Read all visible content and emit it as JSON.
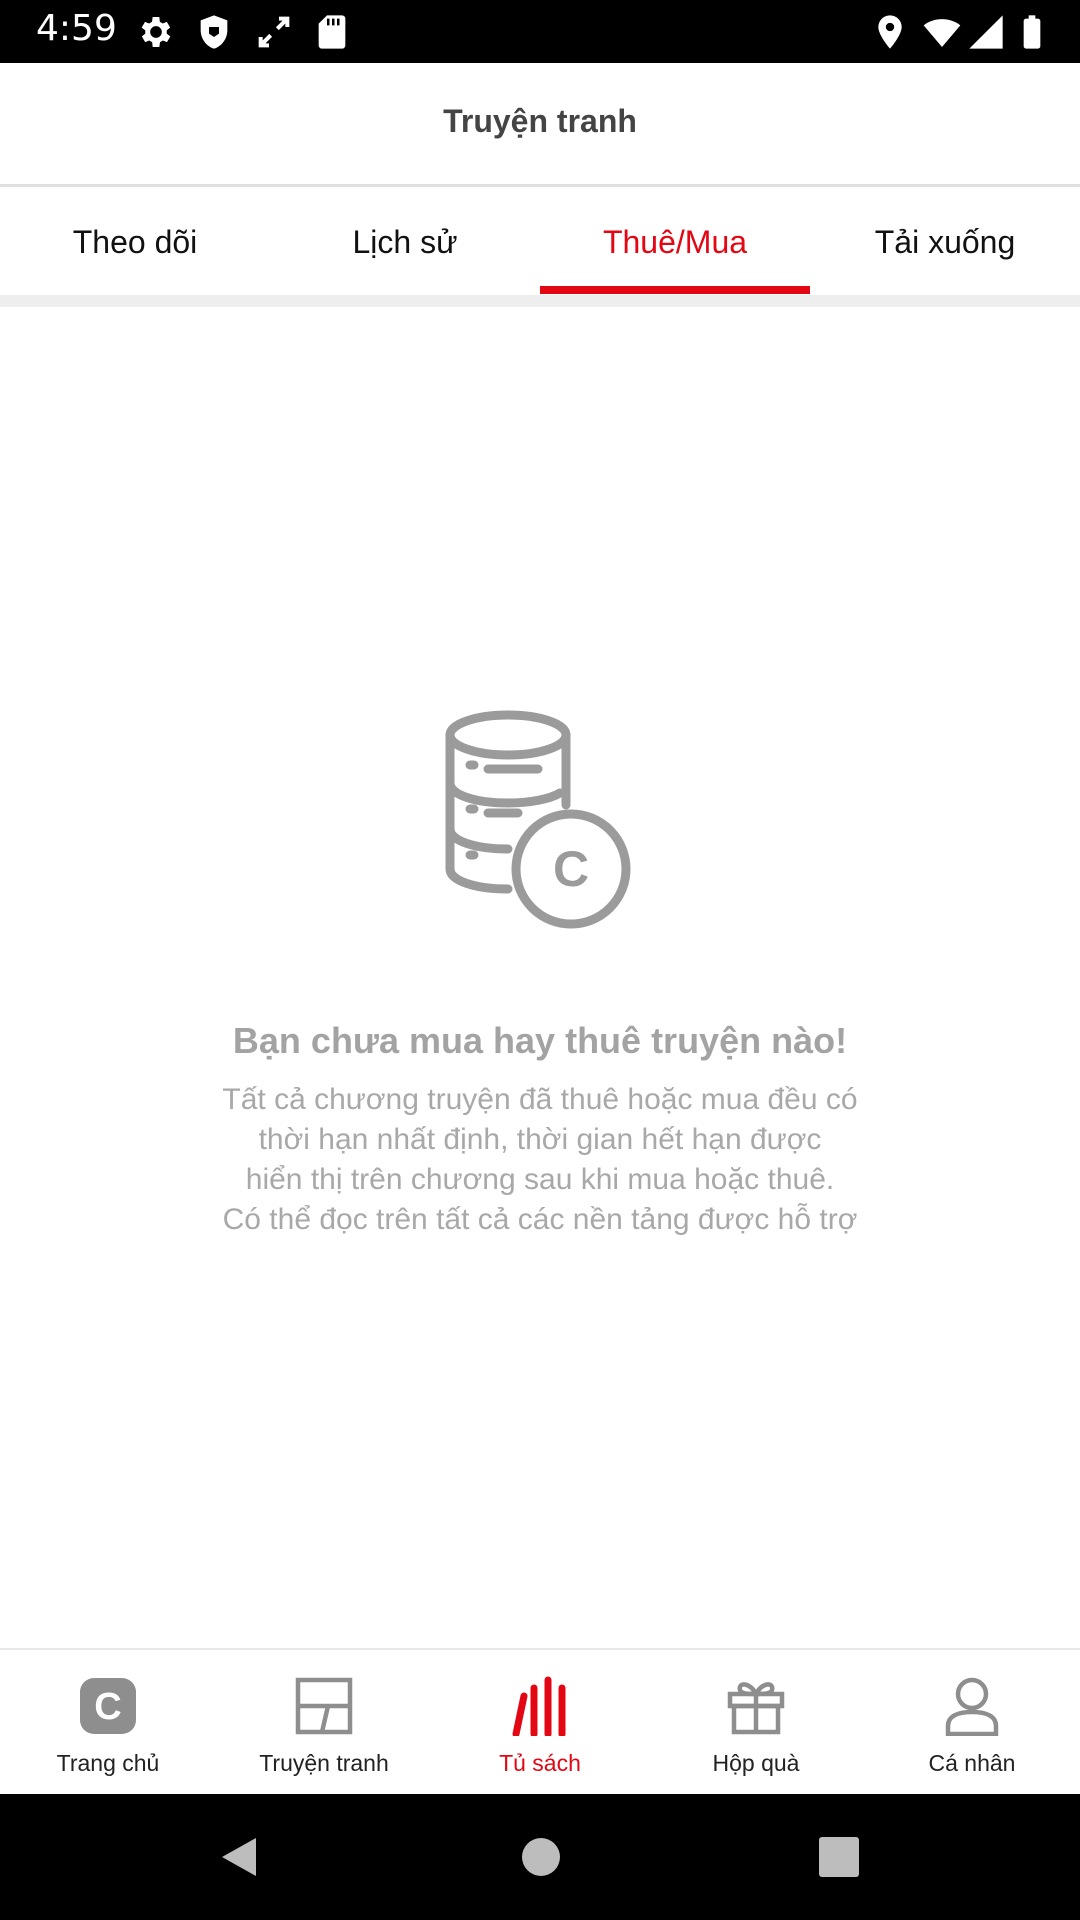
{
  "status_bar": {
    "time": "4:59",
    "left_icons": [
      "gear-icon",
      "shield-icon",
      "arrows-icon",
      "sd-card-icon"
    ],
    "right_icons": [
      "location-icon",
      "wifi-icon",
      "signal-icon",
      "battery-icon"
    ]
  },
  "header": {
    "title": "Truyện tranh"
  },
  "tabs": [
    {
      "label": "Theo dõi",
      "active": false
    },
    {
      "label": "Lịch sử",
      "active": false
    },
    {
      "label": "Thuê/Mua",
      "active": true
    },
    {
      "label": "Tải xuống",
      "active": false
    }
  ],
  "empty_state": {
    "icon": "coins-database-icon",
    "icon_letter": "C",
    "title": "Bạn chưa mua hay thuê truyện nào!",
    "description_lines": [
      "Tất cả chương truyện đã thuê hoặc mua đều có",
      "thời hạn nhất định, thời gian hết hạn được",
      "hiển thị trên chương sau khi mua hoặc thuê.",
      "Có thể đọc trên tất cả các nền tảng được hỗ trợ"
    ]
  },
  "bottom_nav": [
    {
      "label": "Trang chủ",
      "icon": "home-c-icon",
      "active": false
    },
    {
      "label": "Truyện tranh",
      "icon": "comic-panel-icon",
      "active": false
    },
    {
      "label": "Tủ sách",
      "icon": "bookshelf-icon",
      "active": true
    },
    {
      "label": "Hộp quà",
      "icon": "gift-icon",
      "active": false
    },
    {
      "label": "Cá nhân",
      "icon": "person-icon",
      "active": false
    }
  ],
  "system_nav": [
    "back-icon",
    "home-icon",
    "recents-icon"
  ],
  "colors": {
    "accent": "#e30613",
    "muted_text": "#a3a3a3",
    "icon_gray": "#9b9b9b"
  }
}
